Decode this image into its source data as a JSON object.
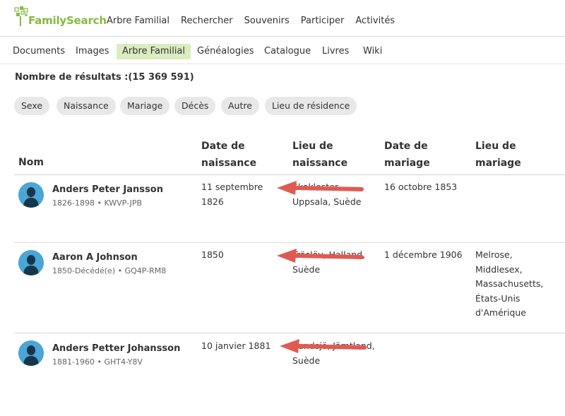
{
  "header": {
    "logo_text_1": "Family",
    "logo_text_2": "Search",
    "nav": [
      "Arbre Familial",
      "Rechercher",
      "Souvenirs",
      "Participer",
      "Activités"
    ]
  },
  "subnav": {
    "items": [
      "Documents",
      "Images",
      "Arbre Familial",
      "Généalogies",
      "Catalogue",
      "Livres",
      "Wiki"
    ],
    "active": "Arbre Familial"
  },
  "results_count": "Nombre de résultats :(15 369 591)",
  "filters": [
    "Sexe",
    "Naissance",
    "Mariage",
    "Décès",
    "Autre",
    "Lieu de résidence"
  ],
  "table": {
    "headers": {
      "name": "Nom",
      "birth_date_1": "Date de",
      "birth_date_2": "naissance",
      "birth_place_1": "Lieu de",
      "birth_place_2": "naissance",
      "marriage_date_1": "Date de",
      "marriage_date_2": "mariage",
      "marriage_place_1": "Lieu de",
      "marriage_place_2": "mariage"
    },
    "rows": [
      {
        "name": "Anders Peter Jansson",
        "meta": "1826-1898 •  KWVP-JPB",
        "birth_date_1": "11 septembre",
        "birth_date_2": "1826",
        "birth_place_1": "Skokloster,",
        "birth_place_2": "Uppsala, Suède",
        "marriage_date": "16 octobre 1853",
        "marriage_place": []
      },
      {
        "name": "Aaron A Johnson",
        "meta": "1850-Décédé(e) •  GQ4P-RM8",
        "birth_date_1": "1850",
        "birth_date_2": "",
        "birth_place_1": "Träslöv, Halland,",
        "birth_place_2": "Suède",
        "marriage_date": "1 décembre 1906",
        "marriage_place": [
          "Melrose,",
          "Middlesex,",
          "Massachusetts,",
          "États-Unis",
          "d'Amérique"
        ]
      },
      {
        "name": "Anders Petter Johansson",
        "meta": "1881-1960 •  GHT4-Y8V",
        "birth_date_1": "10 janvier 1881",
        "birth_date_2": "",
        "birth_place_1": "Sundsjö, Jämtland,",
        "birth_place_2": "Suède",
        "marriage_date": "",
        "marriage_place": []
      }
    ]
  },
  "colors": {
    "brand_green": "#87b940",
    "active_tab_bg": "#dcebc0",
    "chip_bg": "#e8e8e8",
    "avatar_blue": "#4aa6d6",
    "annotation_arrow": "#e05a52"
  },
  "icons": [
    "familysearch-tree-logo-icon",
    "person-avatar-icon",
    "red-annotation-arrow"
  ]
}
